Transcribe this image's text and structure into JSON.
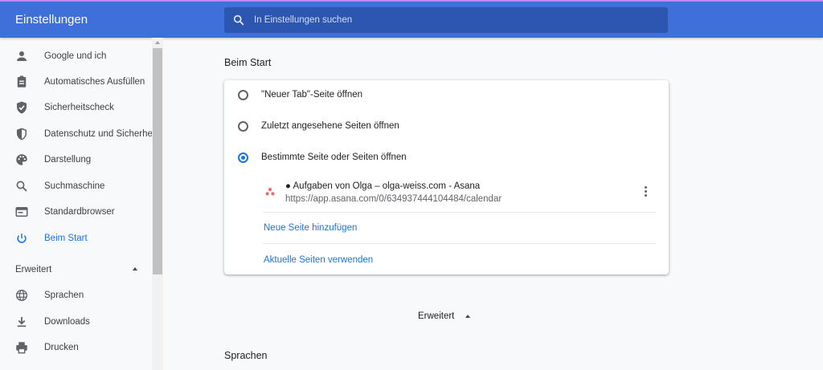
{
  "header": {
    "title": "Einstellungen",
    "search_placeholder": "In Einstellungen suchen",
    "color": "#3f6fd9"
  },
  "sidebar": {
    "items": [
      {
        "label": "Google und ich",
        "icon": "person-icon"
      },
      {
        "label": "Automatisches Ausfüllen",
        "icon": "clipboard-icon"
      },
      {
        "label": "Sicherheitscheck",
        "icon": "shield-check-icon"
      },
      {
        "label": "Datenschutz und Sicherheit",
        "icon": "shield-icon"
      },
      {
        "label": "Darstellung",
        "icon": "palette-icon"
      },
      {
        "label": "Suchmaschine",
        "icon": "search-icon"
      },
      {
        "label": "Standardbrowser",
        "icon": "browser-icon"
      },
      {
        "label": "Beim Start",
        "icon": "power-icon",
        "active": true
      }
    ],
    "advanced_label": "Erweitert",
    "advanced_items": [
      {
        "label": "Sprachen",
        "icon": "globe-icon"
      },
      {
        "label": "Downloads",
        "icon": "download-icon"
      },
      {
        "label": "Drucken",
        "icon": "printer-icon"
      }
    ]
  },
  "main": {
    "section_title": "Beim Start",
    "options": [
      {
        "label": "\"Neuer Tab\"-Seite öffnen",
        "checked": false
      },
      {
        "label": "Zuletzt angesehene Seiten öffnen",
        "checked": false
      },
      {
        "label": "Bestimmte Seite oder Seiten öffnen",
        "checked": true
      }
    ],
    "page_entry": {
      "title": "● Aufgaben von Olga – olga-weiss.com - Asana",
      "url": "https://app.asana.com/0/634937444104484/calendar",
      "icon": "asana-icon"
    },
    "add_page_link": "Neue Seite hinzufügen",
    "use_current_link": "Aktuelle Seiten verwenden",
    "advanced_button": "Erweitert",
    "next_section_title": "Sprachen"
  },
  "colors": {
    "accent": "#1a73e8",
    "asana": "#f06a6a"
  }
}
